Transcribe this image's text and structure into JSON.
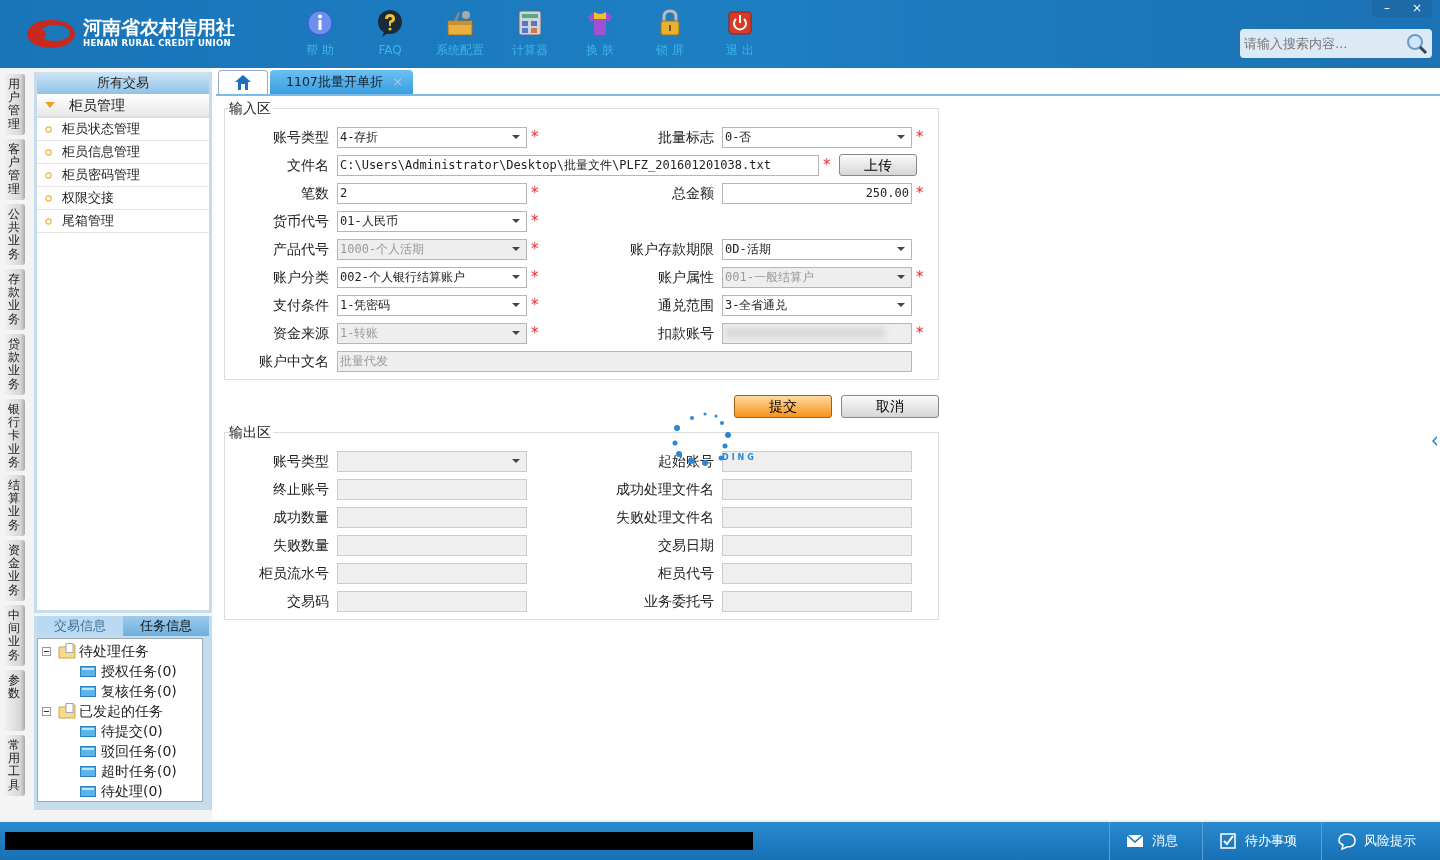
{
  "header": {
    "logo_title": "河南省农村信用社",
    "logo_subtitle": "HENAN RURAL CREDIT UNION",
    "toolbar": [
      {
        "label": "帮 助",
        "kind": "info"
      },
      {
        "label": "FAQ",
        "kind": "help"
      },
      {
        "label": "系统配置",
        "kind": "toolbox"
      },
      {
        "label": "计算器",
        "kind": "calculator"
      },
      {
        "label": "换 肤",
        "kind": "shirt"
      },
      {
        "label": "锁 屏",
        "kind": "lock"
      },
      {
        "label": "退 出",
        "kind": "exit"
      }
    ],
    "search": {
      "placeholder": "请输入搜索内容..."
    },
    "window_controls": [
      "–",
      "×"
    ]
  },
  "side_tabs": [
    "用户管理",
    "客户管理",
    "公共业务",
    "存款业务",
    "贷款业务",
    "银行卡业务",
    "结算业务",
    "资金业务",
    "中间业务",
    "参数",
    "常用工具"
  ],
  "sidebar": {
    "title": "所有交易",
    "group": {
      "label": "柜员管理",
      "expanded": true
    },
    "items": [
      "柜员状态管理",
      "柜员信息管理",
      "柜员密码管理",
      "权限交接",
      "尾箱管理"
    ]
  },
  "task_panel": {
    "tabs": [
      {
        "label": "交易信息",
        "selected": false
      },
      {
        "label": "任务信息",
        "selected": true
      }
    ],
    "tree": [
      {
        "label": "待处理任务",
        "expanded": true,
        "children": [
          {
            "label": "授权任务(0)"
          },
          {
            "label": "复核任务(0)"
          }
        ]
      },
      {
        "label": "已发起的任务",
        "expanded": true,
        "children": [
          {
            "label": "待提交(0)"
          },
          {
            "label": "驳回任务(0)"
          },
          {
            "label": "超时任务(0)"
          },
          {
            "label": "待处理(0)"
          }
        ]
      }
    ]
  },
  "tabs": [
    {
      "label": "1107批量开单折",
      "selected": true,
      "close": "×"
    }
  ],
  "required_mark": "*",
  "input_section": {
    "title": "输入区",
    "rows": [
      [
        {
          "label": "账号类型",
          "kind": "select",
          "value": "4-存折",
          "required": true,
          "disabled": false
        },
        {
          "label": "批量标志",
          "kind": "select",
          "value": "0-否",
          "required": true,
          "disabled": false
        }
      ],
      [
        {
          "label": "文件名",
          "kind": "file",
          "value": "C:\\Users\\Administrator\\Desktop\\批量文件\\PLFZ_201601201038.txt",
          "required": true,
          "disabled": false,
          "button": "上传"
        }
      ],
      [
        {
          "label": "笔数",
          "kind": "text",
          "value": "2",
          "required": true,
          "disabled": false
        },
        {
          "label": "总金额",
          "kind": "amount",
          "value": "250.00",
          "required": true,
          "disabled": false
        }
      ],
      [
        {
          "label": "货币代号",
          "kind": "select",
          "value": "01-人民币",
          "required": true,
          "disabled": false
        }
      ],
      [
        {
          "label": "产品代号",
          "kind": "select",
          "value": "1000-个人活期",
          "required": true,
          "disabled": true
        },
        {
          "label": "账户存款期限",
          "kind": "select",
          "value": "0D-活期",
          "required": false,
          "disabled": false
        }
      ],
      [
        {
          "label": "账户分类",
          "kind": "select",
          "value": "002-个人银行结算账户",
          "required": true,
          "disabled": false
        },
        {
          "label": "账户属性",
          "kind": "select",
          "value": "001-一般结算户",
          "required": true,
          "disabled": true
        }
      ],
      [
        {
          "label": "支付条件",
          "kind": "select",
          "value": "1-凭密码",
          "required": true,
          "disabled": false
        },
        {
          "label": "通兑范围",
          "kind": "select",
          "value": "3-全省通兑",
          "required": false,
          "disabled": false
        }
      ],
      [
        {
          "label": "资金来源",
          "kind": "select",
          "value": "1-转账",
          "required": true,
          "disabled": true
        },
        {
          "label": "扣款账号",
          "kind": "masked",
          "required": true,
          "disabled": true
        }
      ],
      [
        {
          "label": "账户中文名",
          "kind": "wide",
          "value": "批量代发",
          "required": false,
          "disabled": true
        }
      ]
    ]
  },
  "buttons": [
    {
      "label": "提交",
      "kind": "primary"
    },
    {
      "label": "取消",
      "kind": "default"
    }
  ],
  "output_section": {
    "title": "输出区",
    "rows": [
      [
        {
          "label": "账号类型",
          "kind": "select"
        },
        {
          "label": "起始账号",
          "kind": "text"
        }
      ],
      [
        {
          "label": "终止账号",
          "kind": "text"
        },
        {
          "label": "成功处理文件名",
          "kind": "text"
        }
      ],
      [
        {
          "label": "成功数量",
          "kind": "text"
        },
        {
          "label": "失败处理文件名",
          "kind": "text"
        }
      ],
      [
        {
          "label": "失败数量",
          "kind": "text"
        },
        {
          "label": "交易日期",
          "kind": "text"
        }
      ],
      [
        {
          "label": "柜员流水号",
          "kind": "text"
        },
        {
          "label": "柜员代号",
          "kind": "text"
        }
      ],
      [
        {
          "label": "交易码",
          "kind": "text"
        },
        {
          "label": "业务委托号",
          "kind": "text"
        }
      ]
    ]
  },
  "loading": {
    "text": "DING"
  },
  "status_bar": {
    "items": [
      {
        "label": "消息",
        "kind": "message"
      },
      {
        "label": "待办事项",
        "kind": "todo"
      },
      {
        "label": "风险提示",
        "kind": "risk"
      }
    ]
  }
}
